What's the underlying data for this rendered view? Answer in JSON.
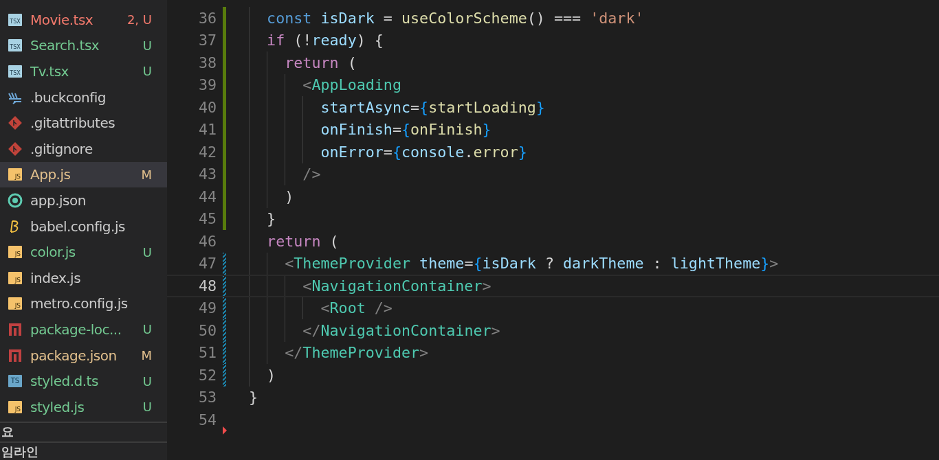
{
  "explorer": {
    "tree": [
      {
        "children": [
          {
            "name": "Movie.tsx",
            "kind": "tsx",
            "icon_text": "TSX",
            "has_errors": true,
            "untracked": true,
            "modified": false,
            "badge": "2, U",
            "selected": false
          },
          {
            "name": "Search.tsx",
            "kind": "tsx",
            "icon_text": "TSX",
            "has_errors": false,
            "untracked": true,
            "modified": false,
            "badge": "U",
            "selected": false
          },
          {
            "name": "Tv.tsx",
            "kind": "tsx",
            "icon_text": "TSX",
            "has_errors": false,
            "untracked": true,
            "modified": false,
            "badge": "U",
            "selected": false
          }
        ]
      },
      {
        "name": ".buckconfig",
        "kind": "buck",
        "has_errors": false,
        "untracked": false,
        "modified": false,
        "selected": false
      },
      {
        "name": ".gitattributes",
        "kind": "git",
        "has_errors": false,
        "untracked": false,
        "modified": false,
        "selected": false
      },
      {
        "name": ".gitignore",
        "kind": "git",
        "has_errors": false,
        "untracked": false,
        "modified": false,
        "selected": false
      },
      {
        "name": "App.js",
        "kind": "js",
        "icon_text": "JS",
        "has_errors": false,
        "untracked": false,
        "modified": true,
        "badge": "M",
        "selected": true
      },
      {
        "name": "app.json",
        "kind": "ring",
        "has_errors": false,
        "untracked": false,
        "modified": false,
        "selected": false
      },
      {
        "name": "babel.config.js",
        "kind": "babel",
        "has_errors": false,
        "untracked": false,
        "modified": false,
        "selected": false
      },
      {
        "name": "color.js",
        "kind": "js",
        "icon_text": "JS",
        "has_errors": false,
        "untracked": true,
        "modified": false,
        "badge": "U",
        "selected": false
      },
      {
        "name": "index.js",
        "kind": "js",
        "icon_text": "JS",
        "has_errors": false,
        "untracked": false,
        "modified": false,
        "selected": false
      },
      {
        "name": "metro.config.js",
        "kind": "js",
        "icon_text": "JS",
        "has_errors": false,
        "untracked": false,
        "modified": false,
        "selected": false
      },
      {
        "name": "package-loc...",
        "kind": "npm",
        "has_errors": false,
        "untracked": true,
        "modified": false,
        "badge": "U",
        "selected": false
      },
      {
        "name": "package.json",
        "kind": "npm",
        "has_errors": false,
        "untracked": false,
        "modified": true,
        "badge": "M",
        "selected": false
      },
      {
        "name": "styled.d.ts",
        "kind": "ts",
        "icon_text": "TS",
        "has_errors": false,
        "untracked": true,
        "modified": false,
        "badge": "U",
        "selected": false
      },
      {
        "name": "styled.js",
        "kind": "js",
        "icon_text": "JS",
        "has_errors": false,
        "untracked": true,
        "modified": false,
        "badge": "U",
        "selected": false
      }
    ],
    "sections": [
      "요",
      "임라인"
    ]
  },
  "editor": {
    "lines": [
      {
        "number": "36",
        "added": true,
        "modified": false,
        "deleted": false,
        "current": false,
        "tokens": [
          {
            "kind": "decl",
            "text": "  const "
          },
          {
            "kind": "var",
            "text": "isDark"
          },
          {
            "kind": "plain",
            "text": " = "
          },
          {
            "kind": "fn",
            "text": "useColorScheme"
          },
          {
            "kind": "plain",
            "text": "() === "
          },
          {
            "kind": "str",
            "text": "'dark'"
          }
        ]
      },
      {
        "number": "37",
        "added": true,
        "modified": false,
        "deleted": false,
        "current": false,
        "tokens": [
          {
            "kind": "kw",
            "text": "  if"
          },
          {
            "kind": "plain",
            "text": " (!"
          },
          {
            "kind": "var",
            "text": "ready"
          },
          {
            "kind": "plain",
            "text": ") {"
          }
        ]
      },
      {
        "number": "38",
        "added": true,
        "modified": false,
        "deleted": false,
        "current": false,
        "tokens": [
          {
            "kind": "kw",
            "text": "    return"
          },
          {
            "kind": "plain",
            "text": " ("
          }
        ]
      },
      {
        "number": "39",
        "added": true,
        "modified": false,
        "deleted": false,
        "current": false,
        "tokens": [
          {
            "kind": "angle",
            "text": "      <"
          },
          {
            "kind": "tag",
            "text": "AppLoading"
          }
        ]
      },
      {
        "number": "40",
        "added": true,
        "modified": false,
        "deleted": false,
        "current": false,
        "tokens": [
          {
            "kind": "var",
            "text": "        startAsync"
          },
          {
            "kind": "plain",
            "text": "="
          },
          {
            "kind": "brace",
            "text": "{"
          },
          {
            "kind": "fn",
            "text": "startLoading"
          },
          {
            "kind": "brace",
            "text": "}"
          }
        ]
      },
      {
        "number": "41",
        "added": true,
        "modified": false,
        "deleted": false,
        "current": false,
        "tokens": [
          {
            "kind": "var",
            "text": "        onFinish"
          },
          {
            "kind": "plain",
            "text": "="
          },
          {
            "kind": "brace",
            "text": "{"
          },
          {
            "kind": "fn",
            "text": "onFinish"
          },
          {
            "kind": "brace",
            "text": "}"
          }
        ]
      },
      {
        "number": "42",
        "added": true,
        "modified": false,
        "deleted": false,
        "current": false,
        "tokens": [
          {
            "kind": "var",
            "text": "        onError"
          },
          {
            "kind": "plain",
            "text": "="
          },
          {
            "kind": "brace",
            "text": "{"
          },
          {
            "kind": "var",
            "text": "console"
          },
          {
            "kind": "plain",
            "text": "."
          },
          {
            "kind": "fn",
            "text": "error"
          },
          {
            "kind": "brace",
            "text": "}"
          }
        ]
      },
      {
        "number": "43",
        "added": true,
        "modified": false,
        "deleted": false,
        "current": false,
        "tokens": [
          {
            "kind": "angle",
            "text": "      />"
          }
        ]
      },
      {
        "number": "44",
        "added": true,
        "modified": false,
        "deleted": false,
        "current": false,
        "tokens": [
          {
            "kind": "plain",
            "text": "    )"
          }
        ]
      },
      {
        "number": "45",
        "added": true,
        "modified": false,
        "deleted": false,
        "current": false,
        "tokens": [
          {
            "kind": "plain",
            "text": "  }"
          }
        ]
      },
      {
        "number": "46",
        "added": false,
        "modified": false,
        "deleted": false,
        "current": false,
        "tokens": [
          {
            "kind": "kw",
            "text": "  return"
          },
          {
            "kind": "plain",
            "text": " ("
          }
        ]
      },
      {
        "number": "47",
        "added": false,
        "modified": true,
        "deleted": false,
        "current": false,
        "tokens": [
          {
            "kind": "angle",
            "text": "    <"
          },
          {
            "kind": "tag",
            "text": "ThemeProvider"
          },
          {
            "kind": "var",
            "text": " theme"
          },
          {
            "kind": "plain",
            "text": "="
          },
          {
            "kind": "brace",
            "text": "{"
          },
          {
            "kind": "var",
            "text": "isDark"
          },
          {
            "kind": "plain",
            "text": " ? "
          },
          {
            "kind": "var",
            "text": "darkTheme"
          },
          {
            "kind": "plain",
            "text": " : "
          },
          {
            "kind": "var",
            "text": "lightTheme"
          },
          {
            "kind": "brace",
            "text": "}"
          },
          {
            "kind": "angle",
            "text": ">"
          }
        ]
      },
      {
        "number": "48",
        "added": false,
        "modified": true,
        "deleted": false,
        "current": true,
        "tokens": [
          {
            "kind": "angle",
            "text": "      <"
          },
          {
            "kind": "tag",
            "text": "NavigationContainer"
          },
          {
            "kind": "angle",
            "text": ">"
          }
        ]
      },
      {
        "number": "49",
        "added": false,
        "modified": true,
        "deleted": false,
        "current": false,
        "tokens": [
          {
            "kind": "angle",
            "text": "        <"
          },
          {
            "kind": "tag",
            "text": "Root"
          },
          {
            "kind": "angle",
            "text": " />"
          }
        ]
      },
      {
        "number": "50",
        "added": false,
        "modified": true,
        "deleted": false,
        "current": false,
        "tokens": [
          {
            "kind": "angle",
            "text": "      </"
          },
          {
            "kind": "tag",
            "text": "NavigationContainer"
          },
          {
            "kind": "angle",
            "text": ">"
          }
        ]
      },
      {
        "number": "51",
        "added": false,
        "modified": true,
        "deleted": false,
        "current": false,
        "tokens": [
          {
            "kind": "angle",
            "text": "    </"
          },
          {
            "kind": "tag",
            "text": "ThemeProvider"
          },
          {
            "kind": "angle",
            "text": ">"
          }
        ]
      },
      {
        "number": "52",
        "added": false,
        "modified": true,
        "deleted": false,
        "current": false,
        "tokens": [
          {
            "kind": "plain",
            "text": "  )"
          }
        ]
      },
      {
        "number": "53",
        "added": false,
        "modified": false,
        "deleted": false,
        "current": false,
        "tokens": [
          {
            "kind": "plain",
            "text": "}"
          }
        ]
      },
      {
        "number": "54",
        "added": false,
        "modified": false,
        "deleted": true,
        "current": false
      }
    ]
  }
}
